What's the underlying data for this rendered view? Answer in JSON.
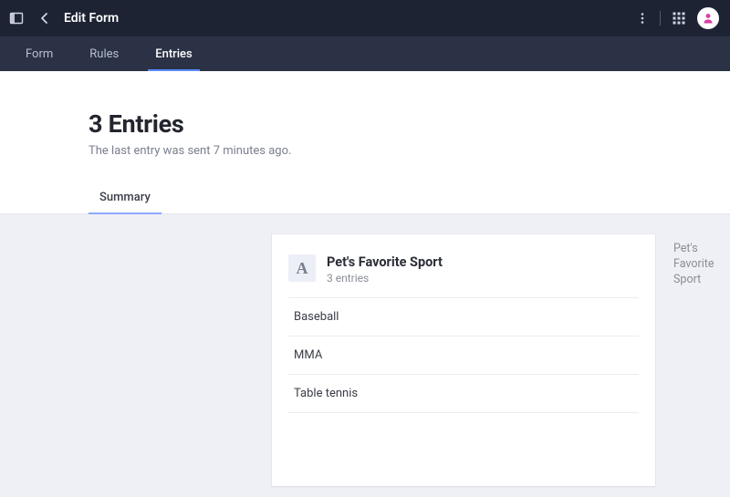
{
  "topbar": {
    "title": "Edit Form"
  },
  "nav": {
    "items": [
      {
        "label": "Form",
        "active": false
      },
      {
        "label": "Rules",
        "active": false
      },
      {
        "label": "Entries",
        "active": true
      }
    ]
  },
  "header": {
    "title": "3 Entries",
    "subtitle": "The last entry was sent 7 minutes ago."
  },
  "subtabs": [
    {
      "label": "Summary",
      "active": true
    }
  ],
  "card": {
    "type_glyph": "A",
    "title": "Pet's Favorite Sport",
    "subtitle": "3 entries",
    "entries": [
      "Baseball",
      "MMA",
      "Table tennis"
    ]
  },
  "sidelink": {
    "label": "Pet's Favorite Sport"
  }
}
